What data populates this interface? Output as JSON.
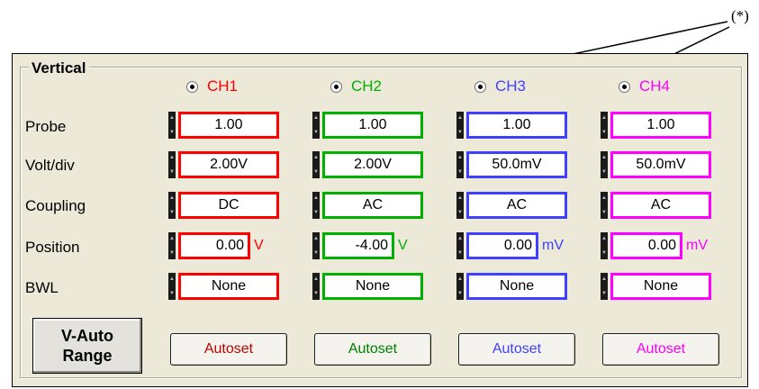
{
  "annotation": "(*)",
  "group_title": "Vertical",
  "row_labels": {
    "probe": "Probe",
    "volt_div": "Volt/div",
    "coupling": "Coupling",
    "position": "Position",
    "bwl": "BWL"
  },
  "vauto": {
    "line1": "V-Auto",
    "line2": "Range"
  },
  "channels": [
    {
      "name": "CH1",
      "color": "#ff0000",
      "probe": "1.00",
      "volt_div": "2.00V",
      "coupling": "DC",
      "position": "0.00",
      "position_unit": "V",
      "bwl": "None",
      "autoset": "Autoset",
      "autoset_color": "#c00000"
    },
    {
      "name": "CH2",
      "color": "#00b000",
      "probe": "1.00",
      "volt_div": "2.00V",
      "coupling": "AC",
      "position": "-4.00",
      "position_unit": "V",
      "bwl": "None",
      "autoset": "Autoset",
      "autoset_color": "#008000"
    },
    {
      "name": "CH3",
      "color": "#4040ff",
      "probe": "1.00",
      "volt_div": "50.0mV",
      "coupling": "AC",
      "position": "0.00",
      "position_unit": "mV",
      "bwl": "None",
      "autoset": "Autoset",
      "autoset_color": "#4040ff"
    },
    {
      "name": "CH4",
      "color": "#ff00ff",
      "probe": "1.00",
      "volt_div": "50.0mV",
      "coupling": "AC",
      "position": "0.00",
      "position_unit": "mV",
      "bwl": "None",
      "autoset": "Autoset",
      "autoset_color": "#ff00ff"
    }
  ]
}
